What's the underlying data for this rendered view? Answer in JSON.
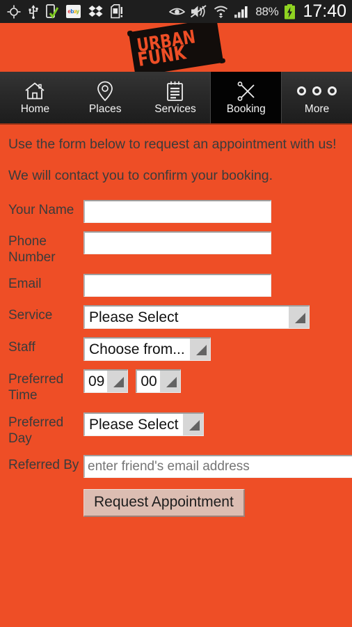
{
  "status_bar": {
    "icons": [
      {
        "name": "gps-icon",
        "glyph": "crosshair"
      },
      {
        "name": "usb-icon",
        "glyph": "usb"
      },
      {
        "name": "phone-connected-icon",
        "glyph": "phone-check"
      },
      {
        "name": "ebay-icon",
        "glyph": "ebay"
      },
      {
        "name": "dropbox-icon",
        "glyph": "dropbox"
      },
      {
        "name": "sd-card-alert-icon",
        "glyph": "sd-alert"
      },
      {
        "name": "smart-stay-eye-icon",
        "glyph": "eye"
      },
      {
        "name": "sound-mute-icon",
        "glyph": "mute"
      },
      {
        "name": "wifi-icon",
        "glyph": "wifi"
      },
      {
        "name": "cellular-signal-icon",
        "glyph": "signal"
      }
    ],
    "battery_percent": "88%",
    "battery_state": "charging",
    "clock": "17:40"
  },
  "brand": {
    "logo_line1": "URBAN",
    "logo_line2": "FUNK",
    "logo_bg": "#120d0b",
    "logo_text_color": "#EE4E26"
  },
  "theme": {
    "page_background": "#EE4E26",
    "label_color": "#3b3b3b",
    "nav_active_background": "#030303",
    "button_background": "#dcbdb2"
  },
  "nav": {
    "items": [
      {
        "label": "Home",
        "icon": "home-icon",
        "active": false
      },
      {
        "label": "Places",
        "icon": "map-pin-icon",
        "active": false
      },
      {
        "label": "Services",
        "icon": "notepad-icon",
        "active": false
      },
      {
        "label": "Booking",
        "icon": "scissors-icon",
        "active": true
      },
      {
        "label": "More",
        "icon": "three-circles-icon",
        "active": false
      }
    ]
  },
  "main": {
    "intro_line1": "Use the form below to request an appointment with us!",
    "intro_line2": "We will contact you to confirm your booking.",
    "form": {
      "name": {
        "label": "Your Name",
        "value": "",
        "placeholder": ""
      },
      "phone": {
        "label": "Phone Number",
        "value": "",
        "placeholder": ""
      },
      "email": {
        "label": "Email",
        "value": "",
        "placeholder": ""
      },
      "service": {
        "label": "Service",
        "selected": "Please Select"
      },
      "staff": {
        "label": "Staff",
        "selected": "Choose from..."
      },
      "preferred_time": {
        "label": "Preferred Time",
        "hour": "09",
        "minute": "00"
      },
      "preferred_day": {
        "label": "Preferred Day",
        "selected": "Please Select"
      },
      "referred_by": {
        "label": "Referred By",
        "value": "",
        "placeholder": "enter friend's email address"
      },
      "submit_label": "Request Appointment"
    }
  }
}
